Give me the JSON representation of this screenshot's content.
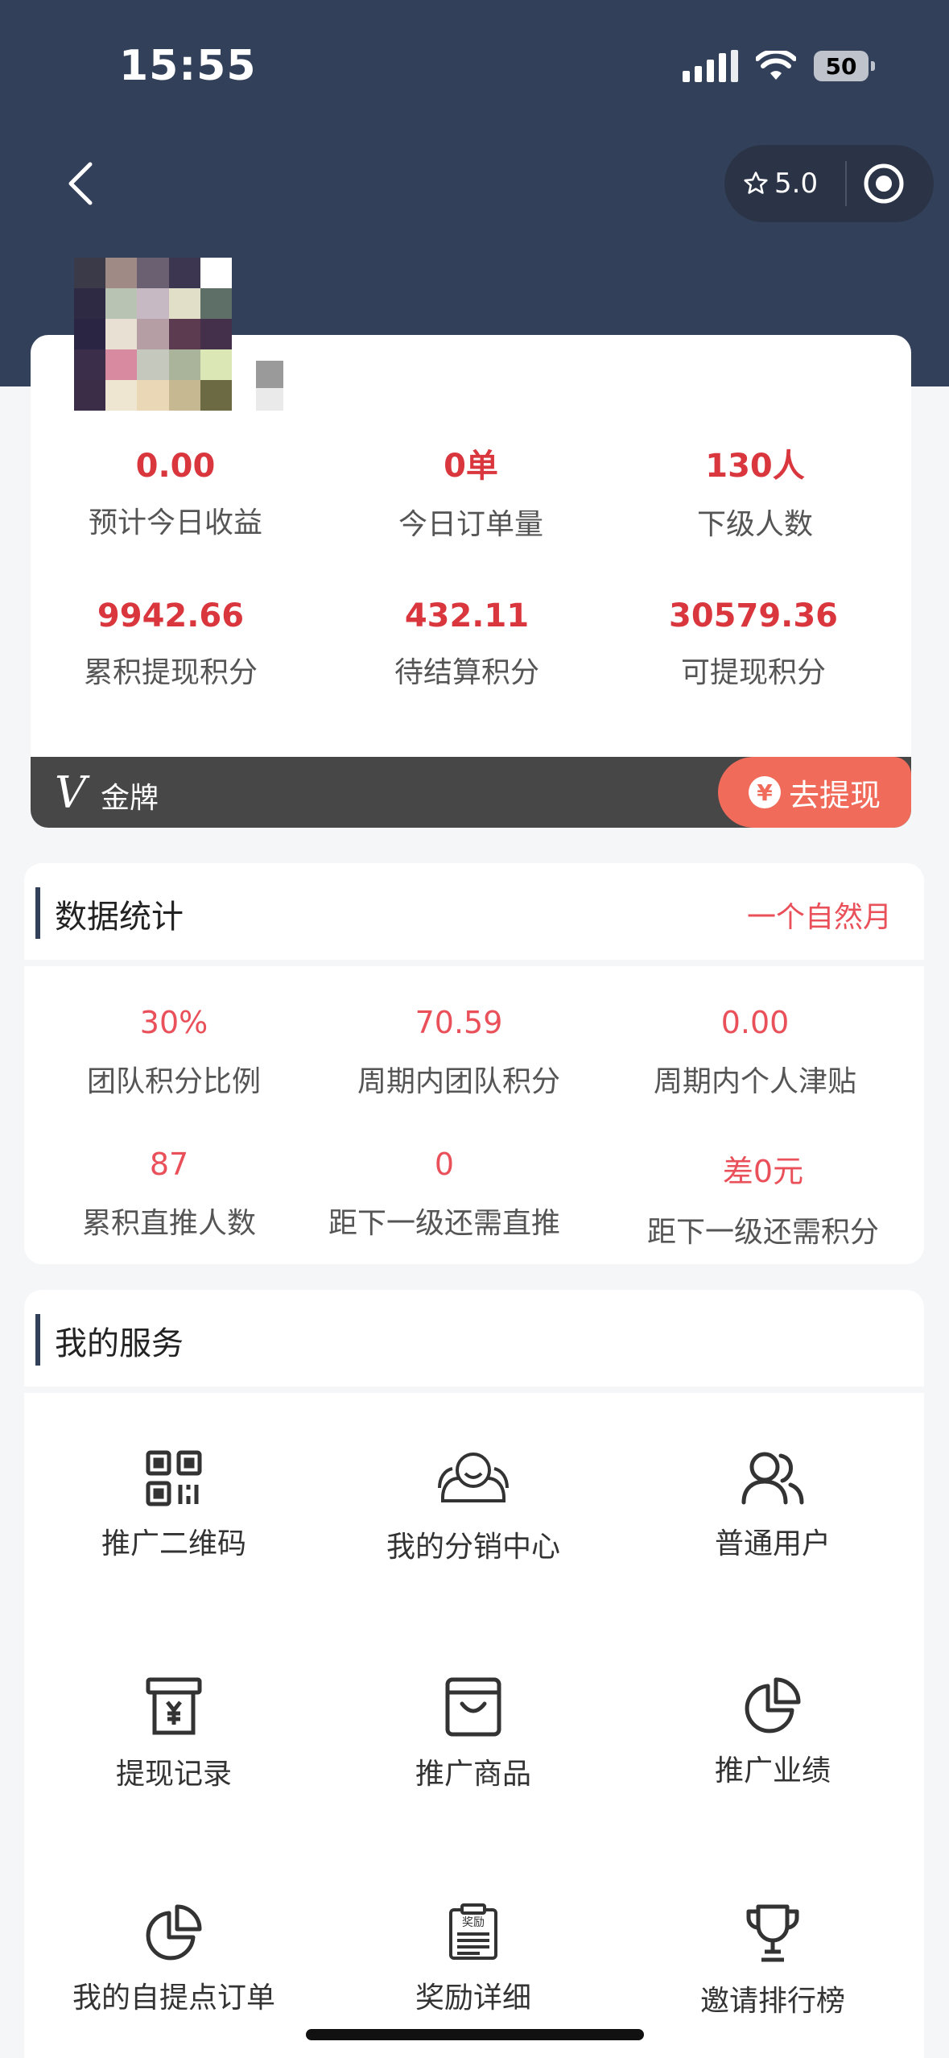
{
  "status_bar": {
    "time": "15:55",
    "battery": "50"
  },
  "capsule": {
    "rating": "5.0"
  },
  "summary": {
    "row1": [
      {
        "value": "0.00",
        "label": "预计今日收益"
      },
      {
        "value": "0单",
        "label": "今日订单量"
      },
      {
        "value": "130人",
        "label": "下级人数"
      }
    ],
    "row2": [
      {
        "value": "9942.66",
        "label": "累积提现积分"
      },
      {
        "value": "432.11",
        "label": "待结算积分"
      },
      {
        "value": "30579.36",
        "label": "可提现积分"
      }
    ],
    "vip_mark": "V",
    "vip_label": "金牌",
    "withdraw_icon": "¥",
    "withdraw_label": "去提现"
  },
  "data_stats": {
    "title": "数据统计",
    "period": "一个自然月",
    "row1": [
      {
        "value": "30%",
        "label": "团队积分比例"
      },
      {
        "value": "70.59",
        "label": "周期内团队积分"
      },
      {
        "value": "0.00",
        "label": "周期内个人津贴"
      }
    ],
    "row2": [
      {
        "value": "87",
        "label": "累积直推人数"
      },
      {
        "value": "0",
        "label": "距下一级还需直推"
      },
      {
        "value": "差0元",
        "label": "距下一级还需积分"
      }
    ]
  },
  "services": {
    "title": "我的服务",
    "items": [
      {
        "label": "推广二维码",
        "icon": "qrcode-icon"
      },
      {
        "label": "我的分销中心",
        "icon": "distribution-center-icon"
      },
      {
        "label": "普通用户",
        "icon": "users-icon"
      },
      {
        "label": "提现记录",
        "icon": "withdraw-record-icon"
      },
      {
        "label": "推广商品",
        "icon": "shopping-bag-icon"
      },
      {
        "label": "推广业绩",
        "icon": "pie-chart-icon"
      },
      {
        "label": "我的自提点订单",
        "icon": "pie-chart-icon"
      },
      {
        "label": "奖励详细",
        "icon": "reward-detail-icon"
      },
      {
        "label": "邀请排行榜",
        "icon": "trophy-icon"
      }
    ],
    "reward_icon_text": "奖励"
  },
  "colors": {
    "header": "#33405a",
    "accent_red": "#d9363e",
    "button": "#f16b5b"
  }
}
